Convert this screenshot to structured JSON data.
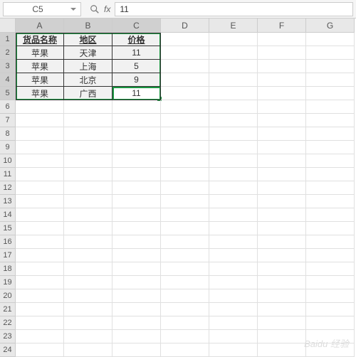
{
  "formula_bar": {
    "name_box": "C5",
    "fx_label": "fx",
    "formula_value": "11"
  },
  "columns": [
    "A",
    "B",
    "C",
    "D",
    "E",
    "F",
    "G"
  ],
  "rows": [
    "1",
    "2",
    "3",
    "4",
    "5",
    "6",
    "7",
    "8",
    "9",
    "10",
    "11",
    "12",
    "13",
    "14",
    "15",
    "16",
    "17",
    "18",
    "19",
    "20",
    "21",
    "22",
    "23",
    "24"
  ],
  "selected_cols": [
    "A",
    "B",
    "C"
  ],
  "selected_rows": [
    "1",
    "2",
    "3",
    "4",
    "5"
  ],
  "active_cell": "C5",
  "chart_data": {
    "type": "table",
    "headers": [
      "货品名称",
      "地区",
      "价格"
    ],
    "rows": [
      [
        "苹果",
        "天津",
        "11"
      ],
      [
        "苹果",
        "上海",
        "5"
      ],
      [
        "苹果",
        "北京",
        "9"
      ],
      [
        "苹果",
        "广西",
        "11"
      ]
    ]
  },
  "watermark": "Baidu 经验"
}
